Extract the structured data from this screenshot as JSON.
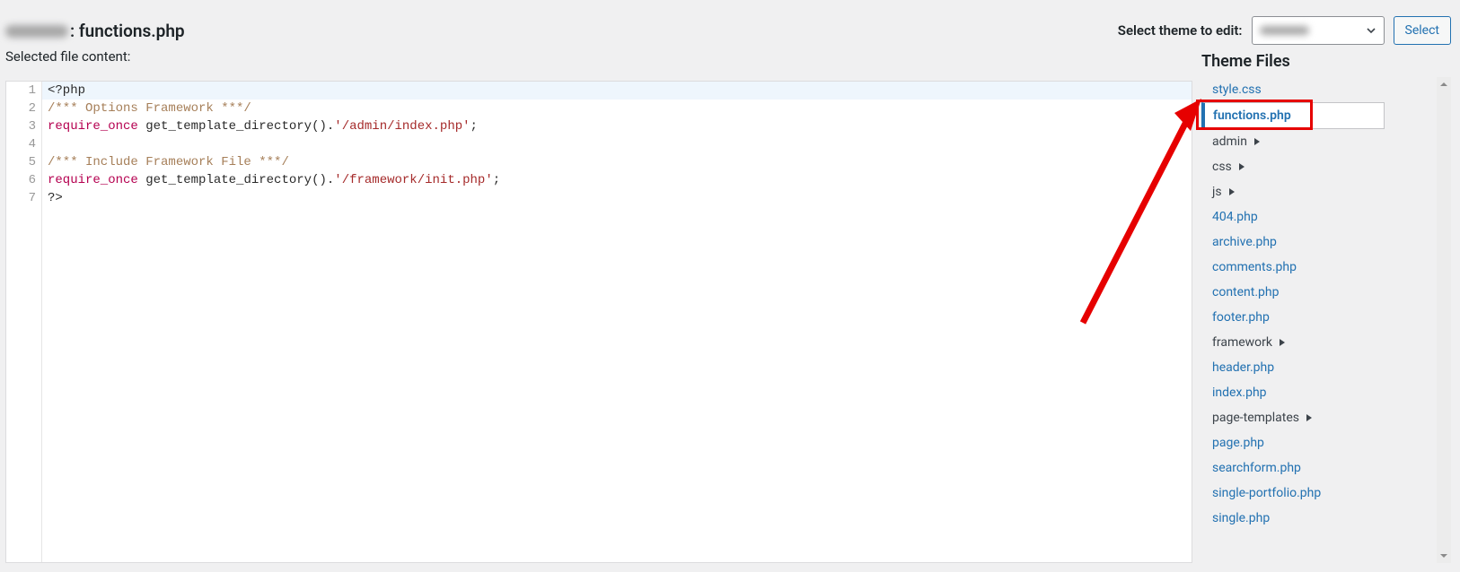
{
  "header": {
    "theme_blurred": true,
    "title_suffix": ": functions.php",
    "select_label": "Select theme to edit:",
    "select_button": "Select"
  },
  "subheader": "Selected file content:",
  "code": {
    "lines": [
      {
        "n": 1,
        "active": true,
        "tokens": [
          {
            "cls": "tok-meta",
            "t": "<?php"
          }
        ]
      },
      {
        "n": 2,
        "tokens": [
          {
            "cls": "tok-comment",
            "t": "/*** Options Framework ***/"
          }
        ]
      },
      {
        "n": 3,
        "tokens": [
          {
            "cls": "tok-keyword2",
            "t": "require_once"
          },
          {
            "cls": "tok-punct",
            "t": " "
          },
          {
            "cls": "tok-func",
            "t": "get_template_directory"
          },
          {
            "cls": "tok-punct",
            "t": "()."
          },
          {
            "cls": "tok-string",
            "t": "'/admin/index.php'"
          },
          {
            "cls": "tok-punct",
            "t": ";"
          }
        ]
      },
      {
        "n": 4,
        "tokens": []
      },
      {
        "n": 5,
        "tokens": [
          {
            "cls": "tok-comment",
            "t": "/*** Include Framework File ***/"
          }
        ]
      },
      {
        "n": 6,
        "tokens": [
          {
            "cls": "tok-keyword2",
            "t": "require_once"
          },
          {
            "cls": "tok-punct",
            "t": " "
          },
          {
            "cls": "tok-func",
            "t": "get_template_directory"
          },
          {
            "cls": "tok-punct",
            "t": "()."
          },
          {
            "cls": "tok-string",
            "t": "'/framework/init.php'"
          },
          {
            "cls": "tok-punct",
            "t": ";"
          }
        ]
      },
      {
        "n": 7,
        "tokens": [
          {
            "cls": "tok-meta",
            "t": "?>"
          }
        ]
      }
    ]
  },
  "sidebar": {
    "title": "Theme Files",
    "items": [
      {
        "label": "style.css",
        "type": "file"
      },
      {
        "label": "functions.php",
        "type": "file",
        "selected": true
      },
      {
        "label": "admin",
        "type": "folder"
      },
      {
        "label": "css",
        "type": "folder"
      },
      {
        "label": "js",
        "type": "folder"
      },
      {
        "label": "404.php",
        "type": "file"
      },
      {
        "label": "archive.php",
        "type": "file"
      },
      {
        "label": "comments.php",
        "type": "file"
      },
      {
        "label": "content.php",
        "type": "file"
      },
      {
        "label": "footer.php",
        "type": "file"
      },
      {
        "label": "framework",
        "type": "folder"
      },
      {
        "label": "header.php",
        "type": "file"
      },
      {
        "label": "index.php",
        "type": "file"
      },
      {
        "label": "page-templates",
        "type": "folder"
      },
      {
        "label": "page.php",
        "type": "file"
      },
      {
        "label": "searchform.php",
        "type": "file"
      },
      {
        "label": "single-portfolio.php",
        "type": "file"
      },
      {
        "label": "single.php",
        "type": "file"
      }
    ]
  }
}
